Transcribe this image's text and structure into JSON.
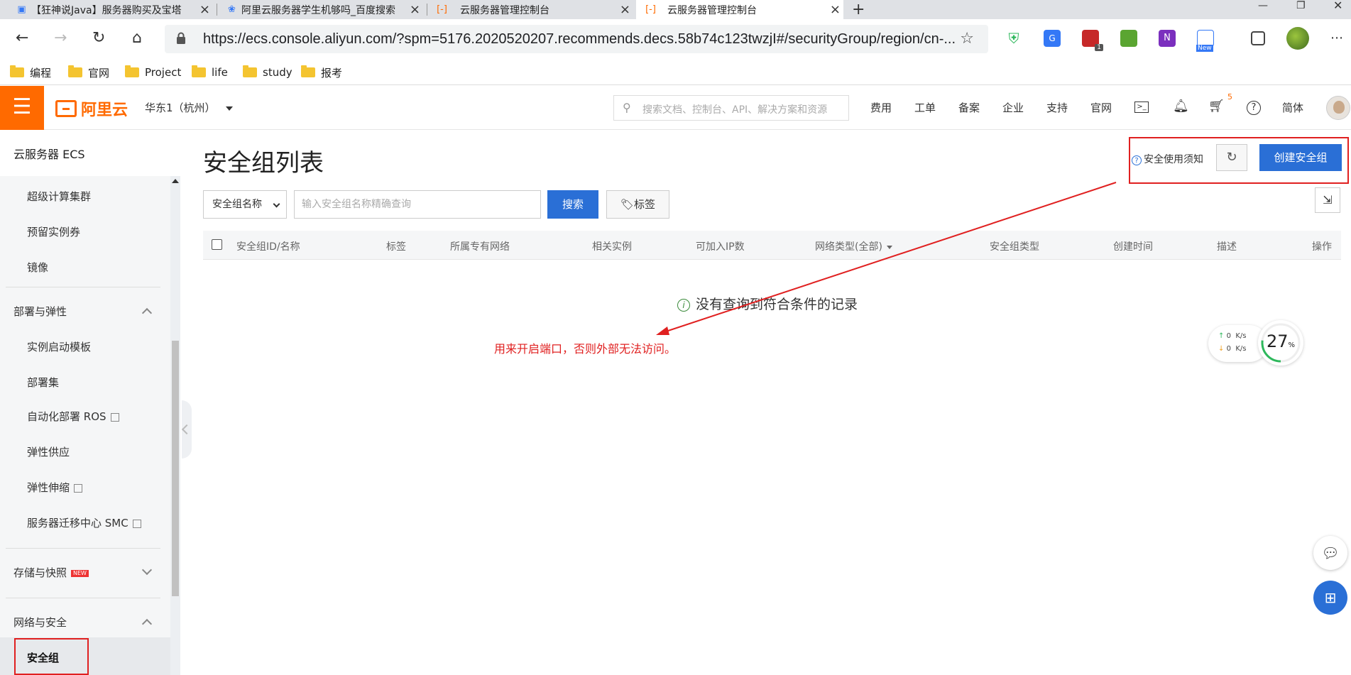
{
  "browser": {
    "tabs": [
      {
        "title": "【狂神说Java】服务器购买及宝塔",
        "icon": "bilibili-icon",
        "active": false
      },
      {
        "title": "阿里云服务器学生机够吗_百度搜索",
        "icon": "baidu-paw-icon",
        "active": false
      },
      {
        "title": "云服务器管理控制台",
        "icon": "aliyun-icon",
        "active": false
      },
      {
        "title": "云服务器管理控制台",
        "icon": "aliyun-icon",
        "active": true
      }
    ],
    "url": "https://ecs.console.aliyun.com/?spm=5176.2020520207.recommends.decs.58b74c123twzjI#/securityGroup/region/cn-...",
    "ext_badge": "1",
    "ext_new_label": "New",
    "bookmarks": [
      "编程",
      "官网",
      "Project",
      "life",
      "study",
      "报考"
    ]
  },
  "console": {
    "region": "华东1（杭州）",
    "search_placeholder": "搜索文档、控制台、API、解决方案和资源",
    "links": [
      "费用",
      "工单",
      "备案",
      "企业",
      "支持",
      "官网"
    ],
    "cart_badge": "5",
    "lang": "简体",
    "accent": "#ff6a00",
    "logo_text": "阿里云"
  },
  "sidebar": {
    "title": "云服务器 ECS",
    "items": {
      "hpc": "超级计算集群",
      "reserved": "预留实例券",
      "image": "镜像",
      "group_deploy": "部署与弹性",
      "launch_template": "实例启动模板",
      "deploy_set": "部署集",
      "ros": "自动化部署 ROS",
      "elastic_supply": "弹性供应",
      "autoscaling": "弹性伸缩",
      "smc": "服务器迁移中心 SMC",
      "group_storage": "存储与快照",
      "new_badge": "NEW",
      "group_network": "网络与安全",
      "security_group": "安全组"
    }
  },
  "main": {
    "title": "安全组列表",
    "help_link": "安全使用须知",
    "create_button": "创建安全组",
    "filter_select": "安全组名称",
    "filter_placeholder": "输入安全组名称精确查询",
    "search_button": "搜索",
    "tag_button": "标签",
    "columns": [
      "安全组ID/名称",
      "标签",
      "所属专有网络",
      "相关实例",
      "可加入IP数",
      "网络类型(全部)",
      "安全组类型",
      "创建时间",
      "描述",
      "操作"
    ],
    "empty_text": "没有查询到符合条件的记录",
    "primary_color": "#2a6fd6"
  },
  "annotation": {
    "text": "用来开启端口，否则外部无法访问。",
    "color": "#e02020"
  },
  "widget": {
    "up_speed": "0",
    "down_speed": "0",
    "unit": "K/s",
    "percent": "27",
    "percent_sign": "%"
  }
}
